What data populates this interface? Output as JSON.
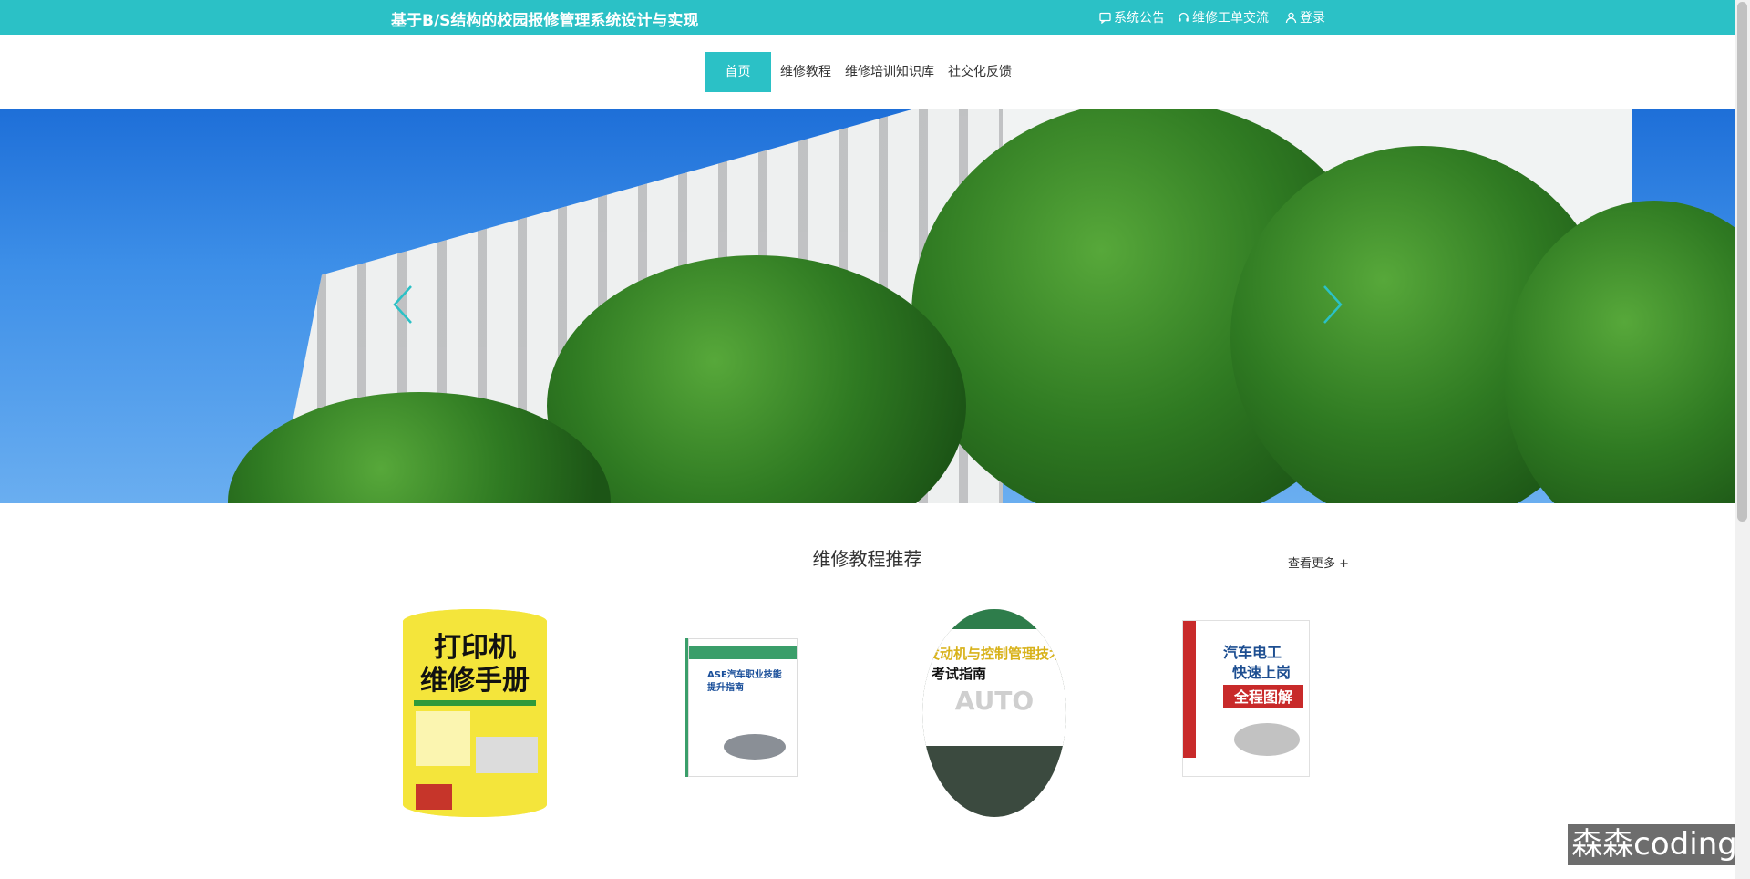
{
  "header": {
    "title": "基于B/S结构的校园报修管理系统设计与实现",
    "links": [
      {
        "label": "系统公告",
        "icon": "message-icon"
      },
      {
        "label": "维修工单交流",
        "icon": "headset-icon"
      },
      {
        "label": "登录",
        "icon": "user-icon"
      }
    ]
  },
  "nav": {
    "items": [
      "首页",
      "维修教程",
      "维修培训知识库",
      "社交化反馈"
    ],
    "active_index": 0
  },
  "banner": {
    "prev_icon": "chevron-left-icon",
    "next_icon": "chevron-right-icon"
  },
  "section": {
    "title": "维修教程推荐",
    "see_more": "查看更多 +"
  },
  "products": [
    {
      "cover_text": "打印机维修手册"
    },
    {
      "cover_text": "ASE汽车职业技能提升指南"
    },
    {
      "cover_text": "发动机与控制管理技术考试指南"
    },
    {
      "cover_text": "汽车电工快速上岗全程图解"
    }
  ],
  "watermark": "森森coding",
  "colors": {
    "accent": "#2bc1c6",
    "text": "#333333"
  }
}
